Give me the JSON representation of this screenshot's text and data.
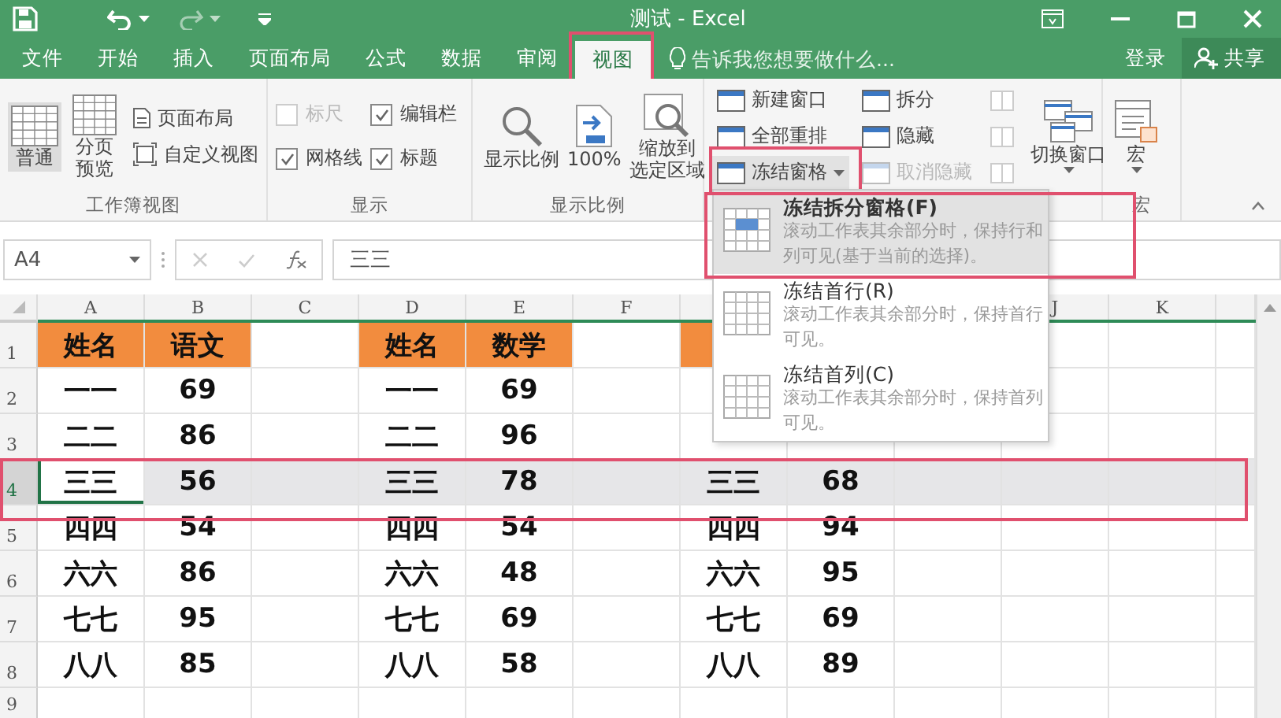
{
  "title_bar": {
    "title": "测试 - Excel"
  },
  "tabs": [
    {
      "label": "文件",
      "selected": false,
      "highlighted": false
    },
    {
      "label": "开始",
      "selected": false,
      "highlighted": false
    },
    {
      "label": "插入",
      "selected": false,
      "highlighted": false
    },
    {
      "label": "页面布局",
      "selected": false,
      "highlighted": false
    },
    {
      "label": "公式",
      "selected": false,
      "highlighted": false
    },
    {
      "label": "数据",
      "selected": false,
      "highlighted": false
    },
    {
      "label": "审阅",
      "selected": false,
      "highlighted": false
    },
    {
      "label": "视图",
      "selected": true,
      "highlighted": true
    }
  ],
  "tell_me": {
    "placeholder": "告诉我您想要做什么..."
  },
  "account": {
    "sign_in": "登录",
    "share": "共享"
  },
  "ribbon": {
    "groups": [
      {
        "label": "工作簿视图",
        "columns": [
          [
            {
              "kind": "large",
              "lines": [
                "普通"
              ],
              "selected": true
            }
          ],
          [
            {
              "kind": "large",
              "lines": [
                "分页",
                "预览"
              ],
              "selected": false
            }
          ],
          [
            {
              "kind": "small",
              "label": "页面布局",
              "selected": false
            },
            {
              "kind": "small",
              "label": "自定义视图",
              "selected": false
            }
          ]
        ]
      },
      {
        "label": "显示",
        "columns": [
          [
            {
              "kind": "check",
              "label": "标尺",
              "checked": false,
              "disabled": true
            },
            {
              "kind": "check",
              "label": "网格线",
              "checked": true,
              "disabled": false
            }
          ],
          [
            {
              "kind": "check",
              "label": "编辑栏",
              "checked": true,
              "disabled": false
            },
            {
              "kind": "check",
              "label": "标题",
              "checked": true,
              "disabled": false
            }
          ]
        ]
      },
      {
        "label": "显示比例",
        "columns": [
          [
            {
              "kind": "large",
              "lines": [
                "显示比例"
              ]
            }
          ],
          [
            {
              "kind": "large",
              "lines": [
                "100%"
              ]
            }
          ],
          [
            {
              "kind": "large",
              "lines": [
                "缩放到",
                "选定区域"
              ]
            }
          ]
        ]
      },
      {
        "columns": [
          [
            {
              "kind": "small",
              "label": "新建窗口",
              "disabled": false,
              "pressed": false,
              "highlighted": false,
              "dropdown": false
            },
            {
              "kind": "small",
              "label": "全部重排",
              "disabled": false,
              "pressed": false,
              "highlighted": false,
              "dropdown": false
            },
            {
              "kind": "small",
              "label": "冻结窗格",
              "disabled": false,
              "pressed": true,
              "highlighted": true,
              "dropdown": true
            }
          ],
          [
            {
              "kind": "small",
              "label": "拆分",
              "disabled": false,
              "pressed": false,
              "highlighted": false,
              "dropdown": false
            },
            {
              "kind": "small",
              "label": "隐藏",
              "disabled": false,
              "pressed": false,
              "highlighted": false,
              "dropdown": false
            },
            {
              "kind": "small",
              "label": "取消隐藏",
              "disabled": true,
              "pressed": false,
              "highlighted": false,
              "dropdown": false
            }
          ],
          [
            {
              "kind": "icon",
              "disabled": true
            },
            {
              "kind": "icon",
              "disabled": true
            },
            {
              "kind": "icon",
              "disabled": true
            }
          ],
          [
            {
              "kind": "large",
              "lines": [
                "切换窗口"
              ],
              "dropdown": true
            }
          ]
        ]
      },
      {
        "label": "宏",
        "columns": [
          [
            {
              "kind": "large",
              "lines": [
                "宏"
              ],
              "dropdown": true
            }
          ]
        ]
      }
    ]
  },
  "formula_bar": {
    "name_box": "A4",
    "formula": "三三"
  },
  "sheet": {
    "left_column_headers": [
      "A",
      "B",
      "C",
      "D",
      "E",
      "F"
    ],
    "right_column_headers": [
      "J",
      "K"
    ],
    "row_headers": [
      {
        "label": "1",
        "selected": false,
        "highlighted": false
      },
      {
        "label": "2",
        "selected": false,
        "highlighted": false
      },
      {
        "label": "3",
        "selected": false,
        "highlighted": false
      },
      {
        "label": "4",
        "selected": true,
        "highlighted": true
      },
      {
        "label": "5",
        "selected": false,
        "highlighted": false
      },
      {
        "label": "6",
        "selected": false,
        "highlighted": false
      },
      {
        "label": "7",
        "selected": false,
        "highlighted": false
      },
      {
        "label": "8",
        "selected": false,
        "highlighted": false
      },
      {
        "label": "9",
        "selected": false,
        "highlighted": false
      }
    ],
    "tables": [
      {
        "header": [
          "姓名",
          "语文"
        ],
        "rows": [
          [
            "一一",
            "69"
          ],
          [
            "二二",
            "86"
          ],
          [
            "三三",
            "56"
          ],
          [
            "四四",
            "54"
          ],
          [
            "六六",
            "86"
          ],
          [
            "七七",
            "95"
          ],
          [
            "八八",
            "85"
          ]
        ]
      },
      {
        "header": [
          "姓名",
          "数学"
        ],
        "rows": [
          [
            "一一",
            "69"
          ],
          [
            "二二",
            "96"
          ],
          [
            "三三",
            "78"
          ],
          [
            "四四",
            "54"
          ],
          [
            "六六",
            "48"
          ],
          [
            "七七",
            "69"
          ],
          [
            "八八",
            "58"
          ]
        ]
      },
      {
        "rows": [
          null,
          null,
          [
            "三三",
            "68"
          ],
          [
            "四四",
            "94"
          ],
          [
            "六六",
            "95"
          ],
          [
            "七七",
            "69"
          ],
          [
            "八八",
            "89"
          ]
        ]
      }
    ]
  },
  "freeze_menu": {
    "items": [
      {
        "title": "冻结拆分窗格(F)",
        "description": "滚动工作表其余部分时，保持行和列可见(基于当前的选择)。",
        "selected": true,
        "highlighted": true
      },
      {
        "title": "冻结首行(R)",
        "description": "滚动工作表其余部分时，保持首行可见。",
        "selected": false,
        "highlighted": false
      },
      {
        "title": "冻结首列(C)",
        "description": "滚动工作表其余部分时，保持首列可见。",
        "selected": false,
        "highlighted": false
      }
    ]
  }
}
